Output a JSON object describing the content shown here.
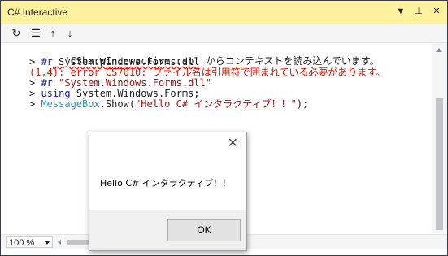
{
  "window": {
    "title": "C# Interactive",
    "buttons": {
      "dropdown": "▼",
      "pin": "⊥",
      "close": "✕"
    },
    "colors": {
      "titlebar": "#fff29d",
      "error": "#e51400",
      "keyword": "#1a1aa6",
      "string": "#a31515",
      "class": "#2b91af"
    }
  },
  "toolbar": {
    "reset_icon": "↻",
    "clear_icon": "☰",
    "history_up_icon": "↑",
    "history_down_icon": "↓"
  },
  "editor": {
    "line1": "'CSharpInteractive.rsp' からコンテキストを読み込んでいます。",
    "line2_prompt": "> ",
    "line2_kw": "#r",
    "line2_rest": " System.Windows.Forms.dll",
    "line3_loc": "(1,4)",
    "line3_rest": ": error CS7010: ファイル名は引用符で囲まれている必要があります。",
    "line4_prompt": "> ",
    "line4_kw": "#r",
    "line4_str": " \"System.Windows.Forms.dll\"",
    "line5_prompt": "> ",
    "line5_kw": "using",
    "line5_rest": " System.Windows.Forms;",
    "line6_prompt": "> ",
    "line6_cls": "MessageBox",
    "line6_mid": ".Show(",
    "line6_str": "\"Hello C# インタラクティブ！！\"",
    "line6_end": ");"
  },
  "status": {
    "zoom": "100 %"
  },
  "dialog": {
    "message": "Hello C# インタラクティブ！！",
    "ok_label": "OK",
    "close_glyph": "✕"
  }
}
